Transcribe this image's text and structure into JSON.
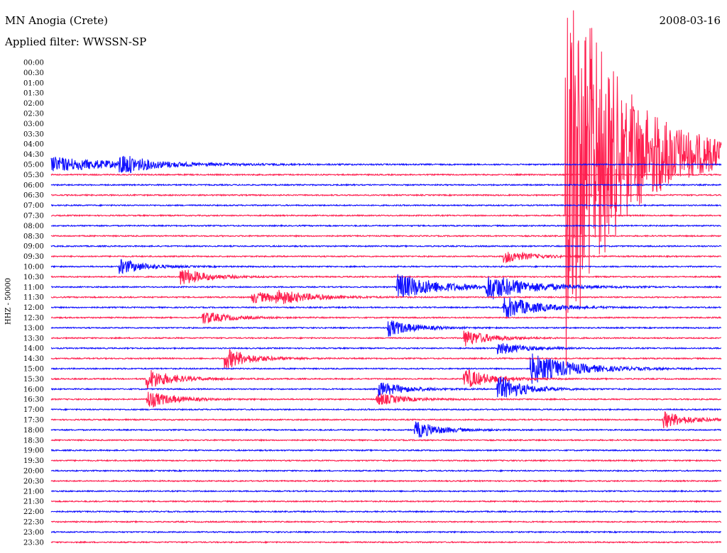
{
  "header": {
    "station": "MN Anogia (Crete)",
    "date": "2008-03-16",
    "filter": "Applied filter: WWSSN-SP"
  },
  "colors": {
    "trace_a": "#ff2050",
    "trace_b": "#1010ff",
    "background": "#ffffff"
  },
  "chart_data": {
    "type": "line",
    "title": "MN Anogia (Crete)",
    "ylabel": "HHZ - 50000",
    "xlabel": "",
    "rows": [
      "00:00",
      "00:30",
      "01:00",
      "01:30",
      "02:00",
      "02:30",
      "03:00",
      "03:30",
      "04:00",
      "04:30",
      "05:00",
      "05:30",
      "06:00",
      "06:30",
      "07:00",
      "07:30",
      "08:00",
      "08:30",
      "09:00",
      "09:30",
      "10:00",
      "10:30",
      "11:00",
      "11:30",
      "12:00",
      "12:30",
      "13:00",
      "13:30",
      "14:00",
      "14:30",
      "15:00",
      "15:30",
      "16:00",
      "16:30",
      "17:00",
      "17:30",
      "18:00",
      "18:30",
      "19:00",
      "19:30",
      "20:00",
      "20:30",
      "21:00",
      "21:30",
      "22:00",
      "22:30",
      "23:00",
      "23:30"
    ],
    "row_colors": [
      "trace_a",
      "trace_b"
    ],
    "row_minutes": 30,
    "noise_level": 0.12,
    "data_start_minute": 293,
    "events": [
      {
        "row": 0,
        "minute": 5.3,
        "amplitude": 8.0,
        "decay": 2
      },
      {
        "row": 0,
        "minute": 10.2,
        "amplitude": 1.7,
        "decay": 3
      },
      {
        "row": 0,
        "minute": 10.7,
        "amplitude": 2.2,
        "decay": 4
      },
      {
        "row": 0,
        "minute": 12.2,
        "amplitude": 1.0,
        "decay": 4
      },
      {
        "row": 0,
        "minute": 18.3,
        "amplitude": 1.3,
        "decay": 4
      },
      {
        "row": 0,
        "minute": 23.2,
        "amplitude": 4.0,
        "decay": 3
      },
      {
        "row": 1,
        "minute": 3.2,
        "amplitude": 1.6,
        "decay": 3
      },
      {
        "row": 10,
        "minute": 20.4,
        "amplitude": 1.2,
        "decay": 3
      },
      {
        "row": 11,
        "minute": 3.2,
        "amplitude": 1.4,
        "decay": 3
      },
      {
        "row": 12,
        "minute": 5.9,
        "amplitude": 1.7,
        "decay": 3
      },
      {
        "row": 13,
        "minute": 15.6,
        "amplitude": 2.6,
        "decay": 5
      },
      {
        "row": 13,
        "minute": 19.6,
        "amplitude": 2.4,
        "decay": 5
      },
      {
        "row": 14,
        "minute": 9.1,
        "amplitude": 1.1,
        "decay": 4
      },
      {
        "row": 14,
        "minute": 10.2,
        "amplitude": 1.0,
        "decay": 4
      },
      {
        "row": 15,
        "minute": 20.4,
        "amplitude": 2.2,
        "decay": 4
      },
      {
        "row": 16,
        "minute": 6.9,
        "amplitude": 1.2,
        "decay": 3
      },
      {
        "row": 17,
        "minute": 15.2,
        "amplitude": 1.6,
        "decay": 3
      },
      {
        "row": 18,
        "minute": 18.6,
        "amplitude": 1.6,
        "decay": 3
      },
      {
        "row": 19,
        "minute": 20.1,
        "amplitude": 1.2,
        "decay": 3
      },
      {
        "row": 20,
        "minute": 7.9,
        "amplitude": 2.0,
        "decay": 3
      },
      {
        "row": 21,
        "minute": 21.6,
        "amplitude": 3.0,
        "decay": 5
      },
      {
        "row": 22,
        "minute": 4.4,
        "amplitude": 2.0,
        "decay": 3
      },
      {
        "row": 22,
        "minute": 18.6,
        "amplitude": 2.0,
        "decay": 3
      },
      {
        "row": 23,
        "minute": 14.8,
        "amplitude": 1.4,
        "decay": 3
      },
      {
        "row": 23,
        "minute": 20.1,
        "amplitude": 2.5,
        "decay": 3
      },
      {
        "row": 24,
        "minute": 14.7,
        "amplitude": 1.2,
        "decay": 3
      },
      {
        "row": 24,
        "minute": 4.4,
        "amplitude": 1.7,
        "decay": 3
      },
      {
        "row": 26,
        "minute": 27.5,
        "amplitude": 1.6,
        "decay": 3
      },
      {
        "row": 27,
        "minute": 16.4,
        "amplitude": 1.6,
        "decay": 3
      }
    ],
    "large_events": [
      {
        "row": 0,
        "minute": 20.3,
        "amplitude": 28,
        "decay": 4,
        "tail_rows": 3
      },
      {
        "row": 0,
        "minute": 22.2,
        "amplitude": 30,
        "decay": 6,
        "tail_rows": 1
      },
      {
        "row": 0,
        "minute": 22.4,
        "amplitude": 18,
        "decay": 10,
        "tail_rows": 2
      }
    ]
  }
}
